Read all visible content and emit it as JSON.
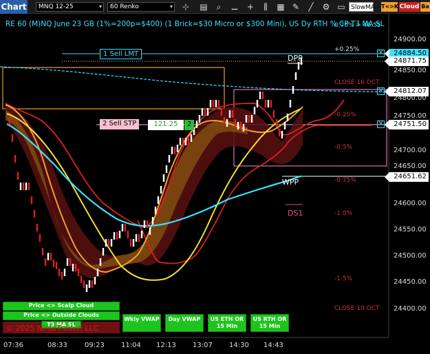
{
  "toolbar": {
    "tab": "Chart",
    "instrument": "MNQ 12-25",
    "interval": "60 Renko",
    "icons": [
      "crosshair-icon",
      "zoom-icon",
      "plus-icon",
      "bars-icon",
      "data-box-icon",
      "drawing-tools-icon",
      "lines-icon",
      "properties-icon",
      "template-icon"
    ],
    "strategy": "SlowMA",
    "tc_button": "T<>K",
    "cloud_button": "Cloud",
    "bar_button": "Ba"
  },
  "chart": {
    "title": "RE 60 (M)NQ June 23 GB (1%=200p=$400) (1 Brick=$30 Micro or $300 Mini), US Dy RTH % CP T3 MA SL",
    "ratio": "0.76% = 46.55",
    "price_axis": [
      "24900.00",
      "24850.00",
      "24800.00",
      "24750.00",
      "24700.00",
      "24650.00",
      "24600.00",
      "24550.00",
      "24500.00",
      "24450.00",
      "24400.00"
    ],
    "price_labels": [
      {
        "value": "24884.50",
        "style": "cyan"
      },
      {
        "value": "24871.75",
        "style": "white"
      },
      {
        "value": "24812.07",
        "style": "white"
      },
      {
        "value": "24751.50",
        "style": "white"
      },
      {
        "value": "24651.62",
        "style": "white"
      }
    ],
    "pct_levels": [
      {
        "label": "+0.25%",
        "color": "#dddddd"
      },
      {
        "label": "CLOSE 16 OCT",
        "color": "#d03040"
      },
      {
        "label": "-0.25%",
        "color": "#d03040"
      },
      {
        "label": "-0.5%",
        "color": "#d03040"
      },
      {
        "label": "-0.75%",
        "color": "#d03040"
      },
      {
        "label": "-1.0%",
        "color": "#d03040"
      },
      {
        "label": "-1.5%",
        "color": "#d03040"
      },
      {
        "label": "CLOSE 10 OCT",
        "color": "#d03040"
      }
    ],
    "time_axis": [
      "07:36",
      "08:33",
      "09:23",
      "11:04",
      "12:13",
      "13:07",
      "14:30",
      "14:43"
    ],
    "orders": {
      "sell_lmt": "1 Sell LMT",
      "sell_stp": "2 Sell STP",
      "sell_stp_price": "121.25",
      "sell_stp_qty": "2"
    },
    "levels": {
      "dpp": "DPP",
      "wpp": "WPP",
      "ds1": "DS1"
    },
    "buttons": {
      "scalp_cloud": "Price <> Scalp Cloud",
      "outside_clouds": "Price <> Outside Clouds",
      "t3_ma_sl": "T3 MA SL",
      "wkly_vwap": "Wkly VWAP",
      "day_vwap": "Day VWAP",
      "us_eth_or": "US ETH OR 15 Min",
      "us_rth_or": "US RTH OR 15 Min"
    },
    "copyright": "© 2025 NinjaTrader, LLC",
    "colors": {
      "accent": "#3ce0ff",
      "bull": "#ffffff",
      "bear": "#e02020",
      "orange": "#f0a030",
      "yellow": "#f5e030",
      "magenta": "#e070b0"
    }
  }
}
